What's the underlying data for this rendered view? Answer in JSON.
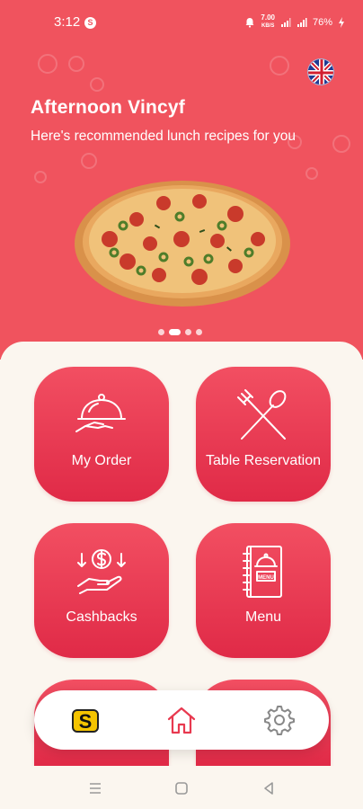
{
  "status_bar": {
    "time": "3:12",
    "notification_badge": "S",
    "network_speed_value": "7.00",
    "network_speed_unit": "KB/S",
    "battery": "76%"
  },
  "hero": {
    "greeting": "Afternoon Vincyf",
    "subtitle": "Here's recommended lunch recipes for you",
    "carousel": {
      "total": 4,
      "active_index": 1
    },
    "language_flag": "uk-flag-icon",
    "background_color": "#f0535e"
  },
  "menu_tiles": [
    {
      "label": "My Order",
      "icon": "serving-cloche-icon"
    },
    {
      "label": "Table Reservation",
      "icon": "fork-spoon-icon"
    },
    {
      "label": "Cashbacks",
      "icon": "cashback-hand-icon"
    },
    {
      "label": "Menu",
      "icon": "menu-book-icon"
    }
  ],
  "bottom_nav": {
    "items": [
      {
        "name": "brand-logo",
        "icon": "s-logo-icon",
        "letter": "S"
      },
      {
        "name": "home",
        "icon": "home-icon",
        "active": true
      },
      {
        "name": "settings",
        "icon": "gear-icon"
      }
    ],
    "accent": "#e8394f"
  },
  "colors": {
    "tile_top": "#f24f62",
    "tile_bottom": "#e02a47",
    "panel": "#fbf6ef"
  }
}
